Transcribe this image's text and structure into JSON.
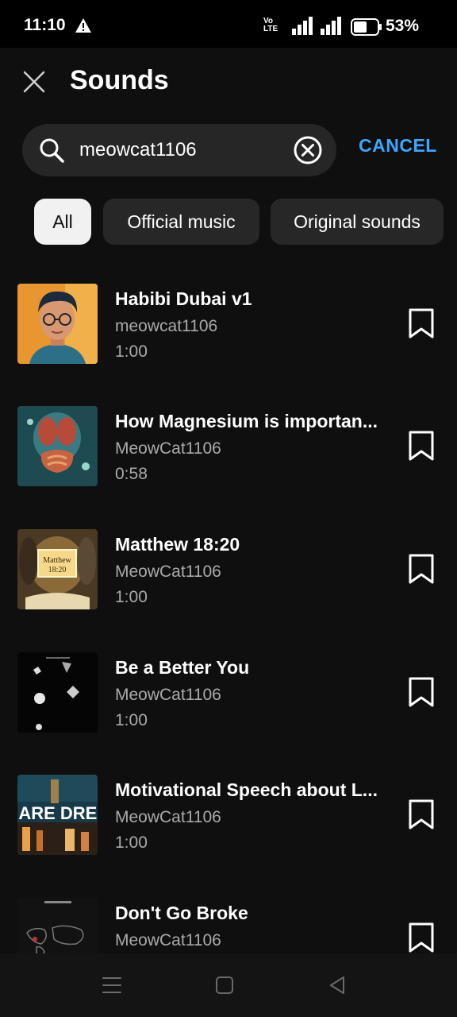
{
  "status_bar": {
    "time": "11:10",
    "volte_line1": "Vo",
    "volte_line2": "LTE",
    "battery_percent": "53%",
    "icons": [
      "warning-icon",
      "volte-icon",
      "signal-icon",
      "signal-icon",
      "battery-icon"
    ]
  },
  "header": {
    "title": "Sounds",
    "close_icon": "close-icon"
  },
  "search": {
    "value": "meowcat1106",
    "cancel_label": "CANCEL",
    "icons": [
      "search-icon",
      "clear-icon"
    ]
  },
  "filters": {
    "chips": [
      {
        "label": "All",
        "active": true
      },
      {
        "label": "Official music",
        "active": false
      },
      {
        "label": "Original sounds",
        "active": false
      }
    ]
  },
  "sounds": [
    {
      "title": "Habibi Dubai v1",
      "artist": "meowcat1106",
      "duration": "1:00"
    },
    {
      "title": "How Magnesium is importan...",
      "artist": "MeowCat1106",
      "duration": "0:58"
    },
    {
      "title": "Matthew 18:20",
      "artist": "MeowCat1106",
      "duration": "1:00",
      "thumb_text_1": "Matthew",
      "thumb_text_2": "18:20"
    },
    {
      "title": "Be a Better You",
      "artist": "MeowCat1106",
      "duration": "1:00"
    },
    {
      "title": "Motivational Speech about L...",
      "artist": "MeowCat1106",
      "duration": "1:00",
      "thumb_text_1": "J ARE DREA"
    },
    {
      "title": "Don't Go Broke",
      "artist": "MeowCat1106",
      "duration": ""
    }
  ],
  "colors": {
    "accent": "#3ea6ff",
    "background": "#0f0f0f",
    "chip": "#272727",
    "chip_active": "#f1f1f1",
    "secondary_text": "#aaaaaa"
  },
  "nav_icons": [
    "menu-icon",
    "home-icon",
    "back-icon"
  ]
}
